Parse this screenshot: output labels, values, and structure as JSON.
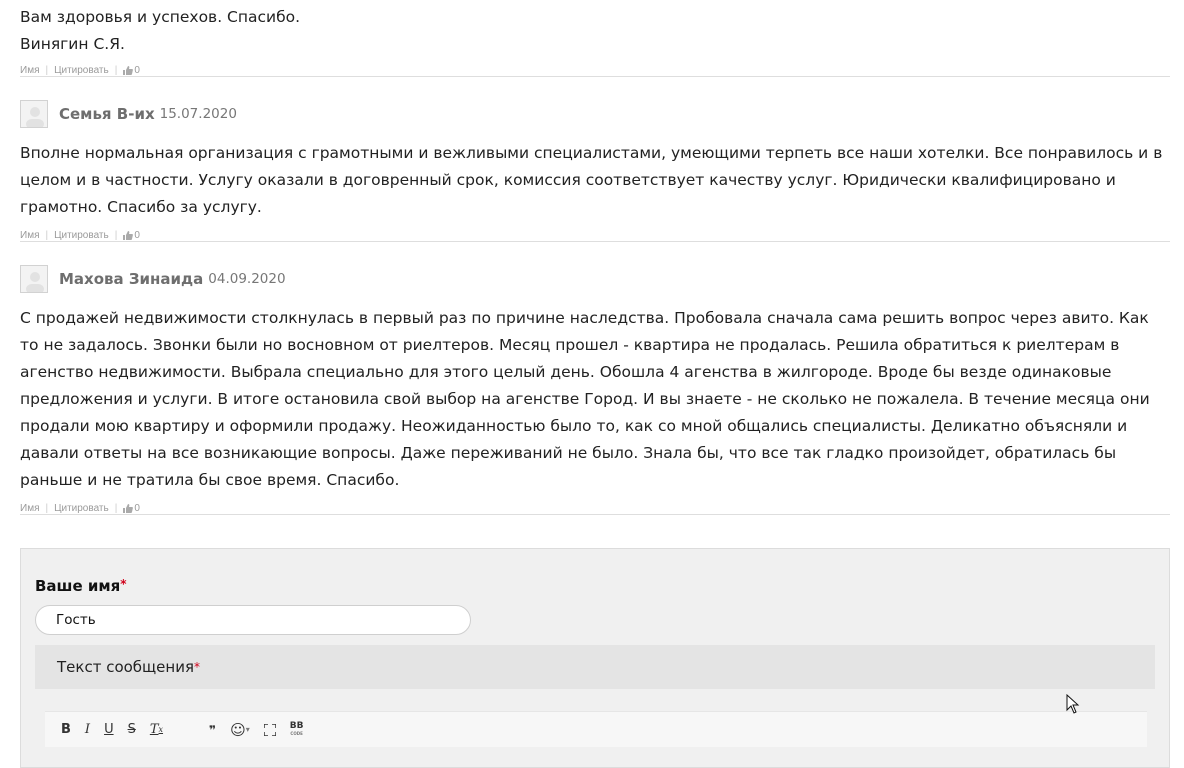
{
  "top_comment": {
    "line1": "Вам здоровья и успехов. Спасибо.",
    "line2": "Винягин С.Я."
  },
  "actions": {
    "name_label": "Имя",
    "quote_label": "Цитировать",
    "separator": "|"
  },
  "comments": [
    {
      "author": "Семья В-их",
      "date": "15.07.2020",
      "text": "Вполне нормальная организация с грамотными и вежливыми специалистами, умеющими терпеть все наши хотелки. Все понравилось и в целом и в частности. Услугу оказали в договренный срок, комиссия соответствует качеству услуг. Юридически квалифицировано и грамотно. Спасибо за услугу.",
      "likes": "0"
    },
    {
      "author": "Махова Зинаида",
      "date": "04.09.2020",
      "text": "С продажей недвижимости столкнулась в первый раз по причине наследства. Пробовала сначала сама решить вопрос через авито. Как то не задалось. Звонки были но восновном от риелтеров. Месяц прошел - квартира не продалась. Решила обратиться к риелтерам в агенство недвижимости. Выбрала специально для этого целый день. Обошла 4 агенства в жилгороде. Вроде бы везде одинаковые предложения и услуги. В итоге остановила свой выбор на агенстве Город. И вы знаете - не сколько не пожалела. В течение месяца они продали мою квартиру и оформили продажу. Неожиданностью было то, как со мной общались специалисты. Деликатно объясняли и давали ответы на все возникающие вопросы. Даже переживаний не было. Знала бы, что все так гладко произойдет, обратилась бы раньше и не тратила бы свое время. Спасибо.",
      "likes": "0"
    }
  ],
  "top_likes": "0",
  "form": {
    "name_label": "Ваше имя",
    "required_mark": "*",
    "name_value": "Гость",
    "message_label": "Текст сообщения"
  },
  "toolbar": {
    "bold": "B",
    "italic": "I",
    "underline": "U",
    "strike": "S",
    "clear": "T",
    "clear_sub": "x",
    "quote": "❞",
    "emoji": "☺",
    "emoji_arrow": "▾",
    "bbcode": "BB",
    "bbcode_sub": "CODE"
  },
  "colors": {
    "required": "#d0021b",
    "author": "#6e6e6e",
    "form_bg": "#f0f0f0"
  }
}
